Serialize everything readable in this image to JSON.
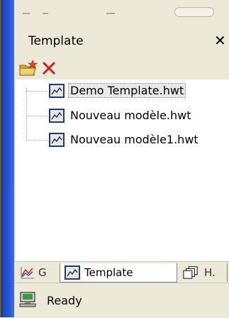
{
  "panel": {
    "title": "Template",
    "close_glyph": "✕"
  },
  "toolbar": {
    "buttons": [
      {
        "icon": "new-template-icon"
      },
      {
        "icon": "delete-red-x-icon"
      }
    ]
  },
  "tree": {
    "items": [
      {
        "label": "Demo Template.hwt",
        "selected": true,
        "icon": "chart-file-icon"
      },
      {
        "label": "Nouveau modèle.hwt",
        "selected": false,
        "icon": "chart-file-icon"
      },
      {
        "label": "Nouveau modèle1.hwt",
        "selected": false,
        "icon": "chart-file-icon"
      }
    ]
  },
  "tabs": [
    {
      "label": "G",
      "icon": "graph-icon",
      "active": false
    },
    {
      "label": "Template",
      "icon": "chart-file-icon",
      "active": true
    },
    {
      "label": "H.",
      "icon": "stacked-docs-icon",
      "active": false
    }
  ],
  "status": {
    "text": "Ready",
    "icon": "computer-network-icon"
  },
  "colors": {
    "chrome": "#ece9d8",
    "xp_blue": "#2255d8",
    "delete_red": "#d11a1a"
  }
}
